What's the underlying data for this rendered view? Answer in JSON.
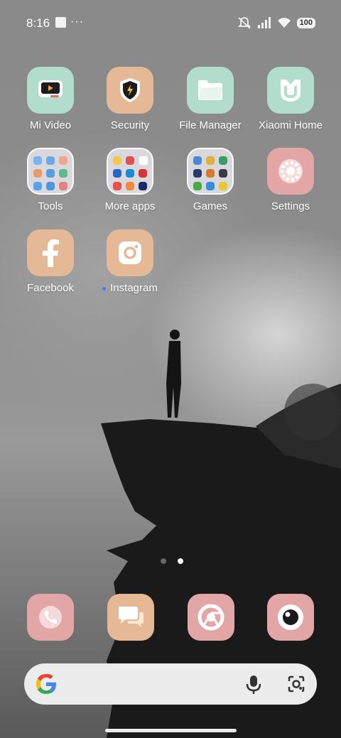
{
  "status_bar": {
    "time": "8:16",
    "dots": "···",
    "battery": "100"
  },
  "apps": [
    {
      "label": "Mi Video",
      "icon": "mi-video-icon"
    },
    {
      "label": "Security",
      "icon": "security-shield-icon"
    },
    {
      "label": "File Manager",
      "icon": "file-manager-icon"
    },
    {
      "label": "Xiaomi Home",
      "icon": "xiaomi-home-icon"
    },
    {
      "label": "Tools",
      "icon": "tools-folder-icon"
    },
    {
      "label": "More apps",
      "icon": "more-apps-folder-icon"
    },
    {
      "label": "Games",
      "icon": "games-folder-icon"
    },
    {
      "label": "Settings",
      "icon": "settings-gear-icon"
    },
    {
      "label": "Facebook",
      "icon": "facebook-icon"
    },
    {
      "label": "Instagram",
      "icon": "instagram-icon"
    }
  ],
  "dock": [
    {
      "icon": "phone-icon"
    },
    {
      "icon": "messages-icon"
    },
    {
      "icon": "chrome-icon"
    },
    {
      "icon": "camera-icon"
    }
  ],
  "pager": {
    "pages": 2,
    "active_index": 1
  },
  "colors": {
    "mint": "#b2dccb",
    "peach": "#e5b896",
    "pink": "#e2a6a6"
  }
}
